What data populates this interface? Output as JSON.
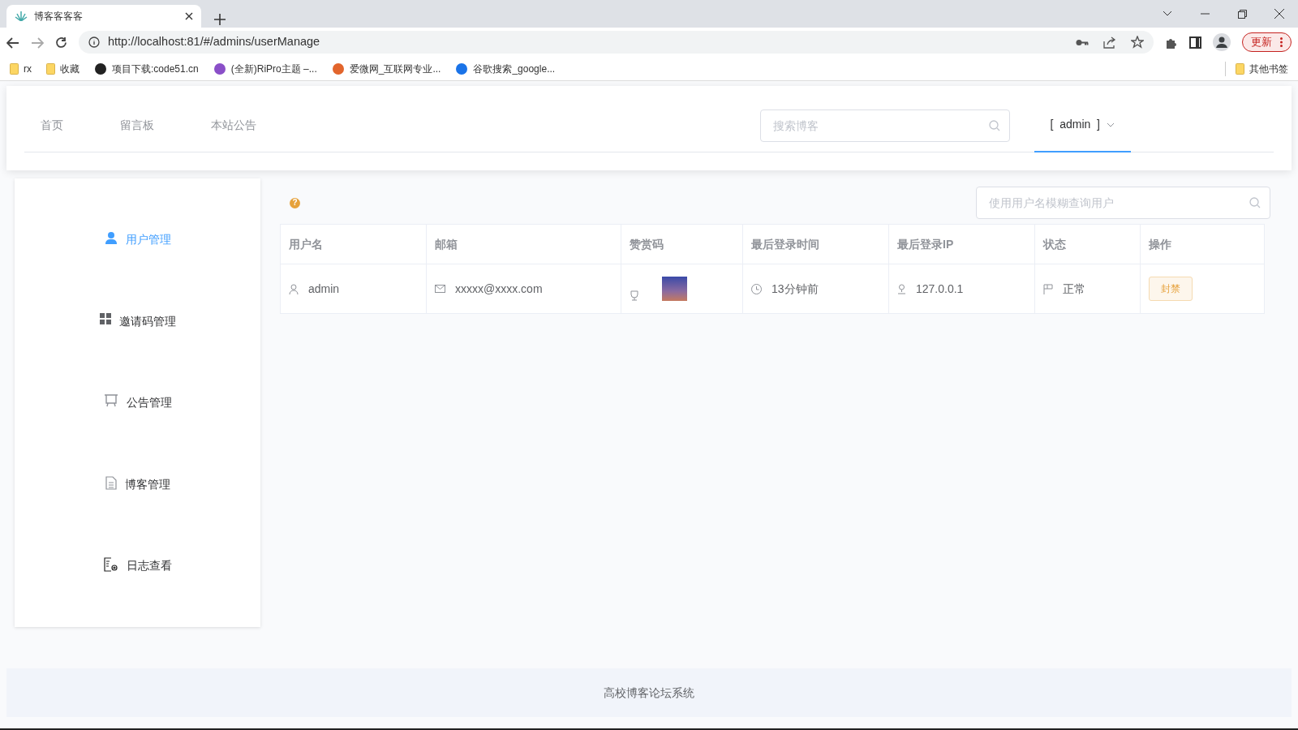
{
  "browser": {
    "tab_title": "博客客客客",
    "url": "http://localhost:81/#/admins/userManage",
    "update_button": "更新",
    "bookmarks": [
      {
        "label": "rx",
        "kind": "folder"
      },
      {
        "label": "收藏",
        "kind": "folder"
      },
      {
        "label": "项目下载:code51.cn",
        "kind": "site"
      },
      {
        "label": "(全新)RiPro主题 –...",
        "kind": "site"
      },
      {
        "label": "爱微网_互联网专业...",
        "kind": "site"
      },
      {
        "label": "谷歌搜索_google...",
        "kind": "site"
      }
    ],
    "other_bookmarks": "其他书签"
  },
  "header": {
    "nav": [
      {
        "label": "首页"
      },
      {
        "label": "留言板"
      },
      {
        "label": "本站公告"
      }
    ],
    "search": {
      "placeholder": "搜索博客"
    },
    "user_menu": {
      "label": "[  admin  ]",
      "selected": true
    }
  },
  "sidebar": {
    "items": [
      {
        "label": "用户管理",
        "selected": true
      },
      {
        "label": "邀请码管理",
        "selected": false
      },
      {
        "label": "公告管理",
        "selected": false
      },
      {
        "label": "博客管理",
        "selected": false
      },
      {
        "label": "日志查看",
        "selected": false
      }
    ]
  },
  "content": {
    "help_icon": "?",
    "search": {
      "placeholder": "使用用户名模糊查询用户"
    },
    "table": {
      "columns": [
        "用户名",
        "邮箱",
        "赞赏码",
        "最后登录时间",
        "最后登录IP",
        "状态",
        "操作"
      ],
      "rows": [
        {
          "username": "admin",
          "email": "xxxxx@xxxx.com",
          "last_login_time": "13分钟前",
          "last_login_ip": "127.0.0.1",
          "status": "正常",
          "action": "封禁"
        }
      ]
    }
  },
  "footer": "高校博客论坛系统"
}
